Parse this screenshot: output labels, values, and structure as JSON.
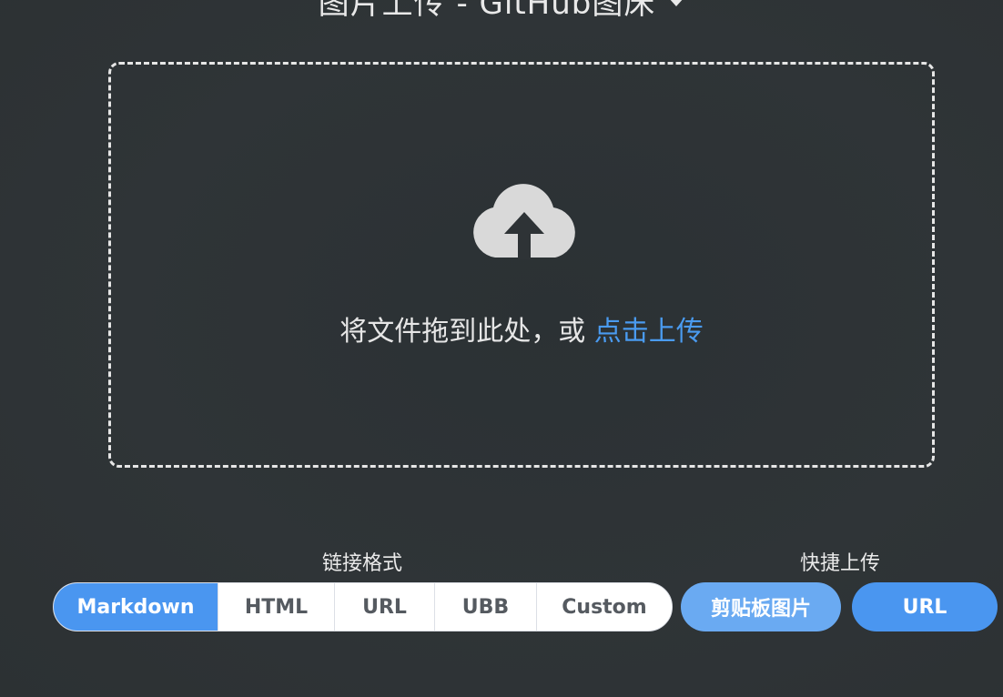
{
  "header": {
    "title": "图片上传 - GitHub图床"
  },
  "dropzone": {
    "text": "将文件拖到此处，或",
    "link": "点击上传"
  },
  "link_format": {
    "label": "链接格式",
    "options": [
      "Markdown",
      "HTML",
      "URL",
      "UBB",
      "Custom"
    ],
    "selected": "Markdown"
  },
  "quick_upload": {
    "label": "快捷上传",
    "clipboard_label": "剪贴板图片",
    "url_label": "URL"
  },
  "colors": {
    "background": "#2f3437",
    "accent": "#4a96f0",
    "accent_light": "#6aaaf2",
    "link": "#4a9bf0"
  },
  "icons": {
    "upload": "cloud-upload-icon",
    "dropdown": "caret-down-icon"
  }
}
